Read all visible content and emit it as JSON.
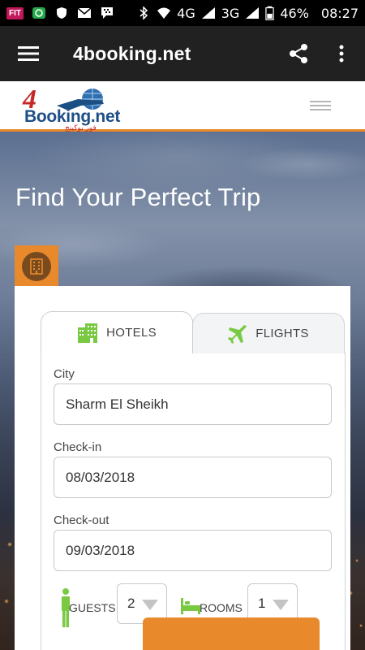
{
  "status_bar": {
    "fit_badge": "FIT",
    "network_4g": "4G",
    "network_3g": "3G",
    "battery": "46%",
    "time": "08:27"
  },
  "app_bar": {
    "title": "4booking.net"
  },
  "logo": {
    "digit": "4",
    "text": "Booking.net",
    "arabic": "فور بوكينج"
  },
  "hero": {
    "title": "Find Your Perfect Trip"
  },
  "tabs": {
    "hotels": "HOTELS",
    "flights": "FLIGHTS"
  },
  "form": {
    "city_label": "City",
    "city_value": "Sharm El Sheikh",
    "checkin_label": "Check-in",
    "checkin_value": "08/03/2018",
    "checkout_label": "Check-out",
    "checkout_value": "09/03/2018",
    "guests_label": "GUESTS",
    "guests_value": "2",
    "rooms_label": "ROOMS",
    "rooms_value": "1"
  },
  "colors": {
    "accent_orange": "#e8892b",
    "icon_green": "#7ac943",
    "app_bar": "#212121"
  },
  "icons": [
    "menu-icon",
    "share-icon",
    "more-vert-icon",
    "hotel-building-icon",
    "plane-icon",
    "person-icon",
    "bed-icon"
  ]
}
